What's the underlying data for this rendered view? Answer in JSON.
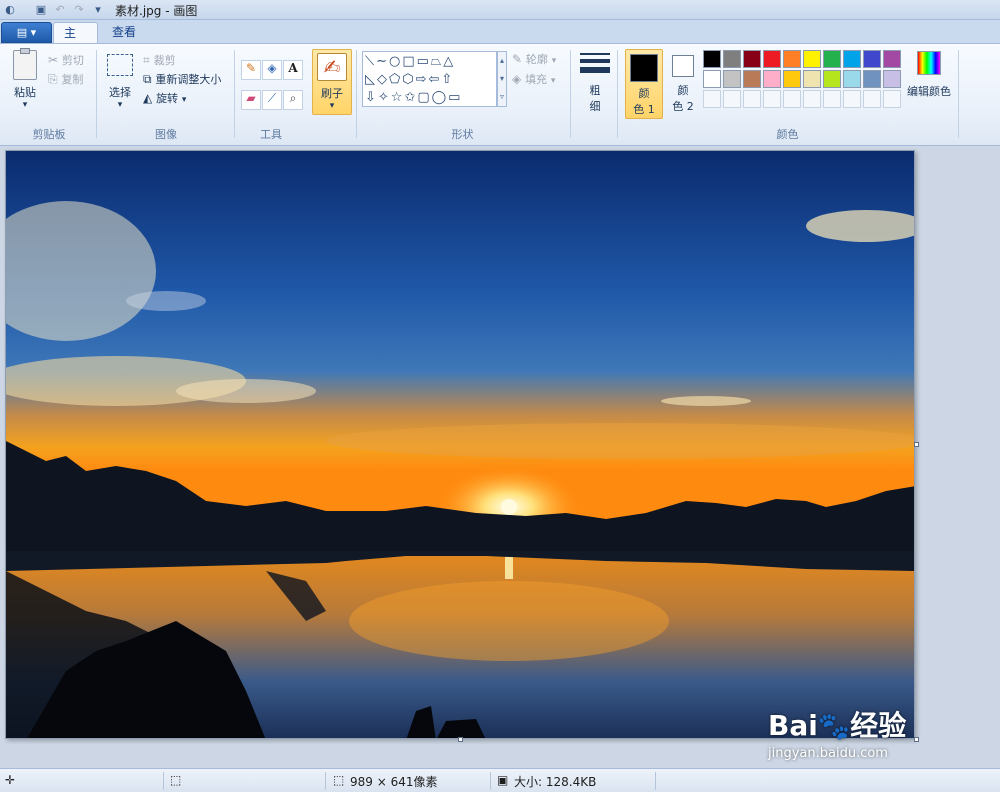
{
  "window": {
    "title": "素材.jpg - 画图"
  },
  "tabs": [
    {
      "label": "主页"
    },
    {
      "label": "查看"
    }
  ],
  "file_button": {
    "label": "▤ ▾"
  },
  "clipboard": {
    "paste_label": "粘贴",
    "cut_label": "剪切",
    "copy_label": "复制",
    "group_label": "剪贴板"
  },
  "image": {
    "select_label": "选择",
    "crop_label": "裁剪",
    "resize_label": "重新调整大小",
    "rotate_label": "旋转",
    "group_label": "图像"
  },
  "tools": {
    "group_label": "工具"
  },
  "brushes": {
    "label": "刷子"
  },
  "shapes": {
    "outline_label": "轮廓",
    "fill_label": "填充",
    "group_label": "形状"
  },
  "size": {
    "label_line1": "粗",
    "label_line2": "细"
  },
  "colors": {
    "color1_label_line1": "颜",
    "color1_label_line2": "色 1",
    "color2_label_line1": "颜",
    "color2_label_line2": "色 2",
    "edit_label": "编辑颜色",
    "group_label": "颜色",
    "color1": "#000000",
    "color2": "#ffffff",
    "palette_row1": [
      "#000000",
      "#7f7f7f",
      "#880015",
      "#ed1c24",
      "#ff7f27",
      "#fff200",
      "#22b14c",
      "#00a2e8",
      "#3f48cc",
      "#a349a4"
    ],
    "palette_row2": [
      "#ffffff",
      "#c3c3c3",
      "#b97a57",
      "#ffaec9",
      "#ffc90e",
      "#efe4b0",
      "#b5e61d",
      "#99d9ea",
      "#7092be",
      "#c8bfe7"
    ]
  },
  "status": {
    "dimensions": "989 × 641像素",
    "file_size": "大小: 128.4KB"
  },
  "watermark": {
    "brand": "Bai",
    "brand_suffix": "经验",
    "url": "jingyan.baidu.com"
  }
}
